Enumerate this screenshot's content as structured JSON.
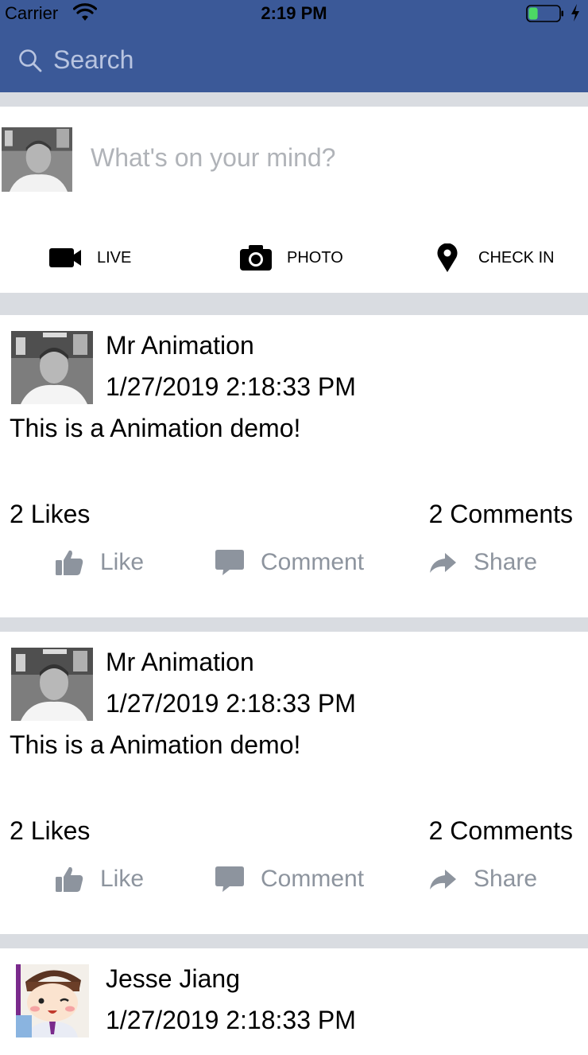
{
  "status_bar": {
    "carrier": "Carrier",
    "time": "2:19 PM",
    "battery_level": 0.3
  },
  "search": {
    "placeholder": "Search"
  },
  "composer": {
    "prompt": "What's on your mind?",
    "actions": [
      {
        "label": "LIVE",
        "icon": "video-camera-icon"
      },
      {
        "label": "PHOTO",
        "icon": "camera-icon"
      },
      {
        "label": "CHECK IN",
        "icon": "location-pin-icon"
      }
    ]
  },
  "posts": [
    {
      "author": "Mr Animation",
      "date": "1/27/2019 2:18:33 PM",
      "text": "This is a Animation demo!",
      "likes": "2 Likes",
      "comments": "2 Comments"
    },
    {
      "author": "Mr Animation",
      "date": "1/27/2019 2:18:33 PM",
      "text": "This is a Animation demo!",
      "likes": "2 Likes",
      "comments": "2 Comments"
    },
    {
      "author": "Jesse Jiang",
      "date": "1/27/2019 2:18:33 PM"
    }
  ],
  "post_actions": {
    "like": "Like",
    "comment": "Comment",
    "share": "Share"
  },
  "colors": {
    "header": "#3b5998",
    "separator": "#d9dce1",
    "muted_text": "#8d949e",
    "battery_fill": "#4cd964"
  }
}
